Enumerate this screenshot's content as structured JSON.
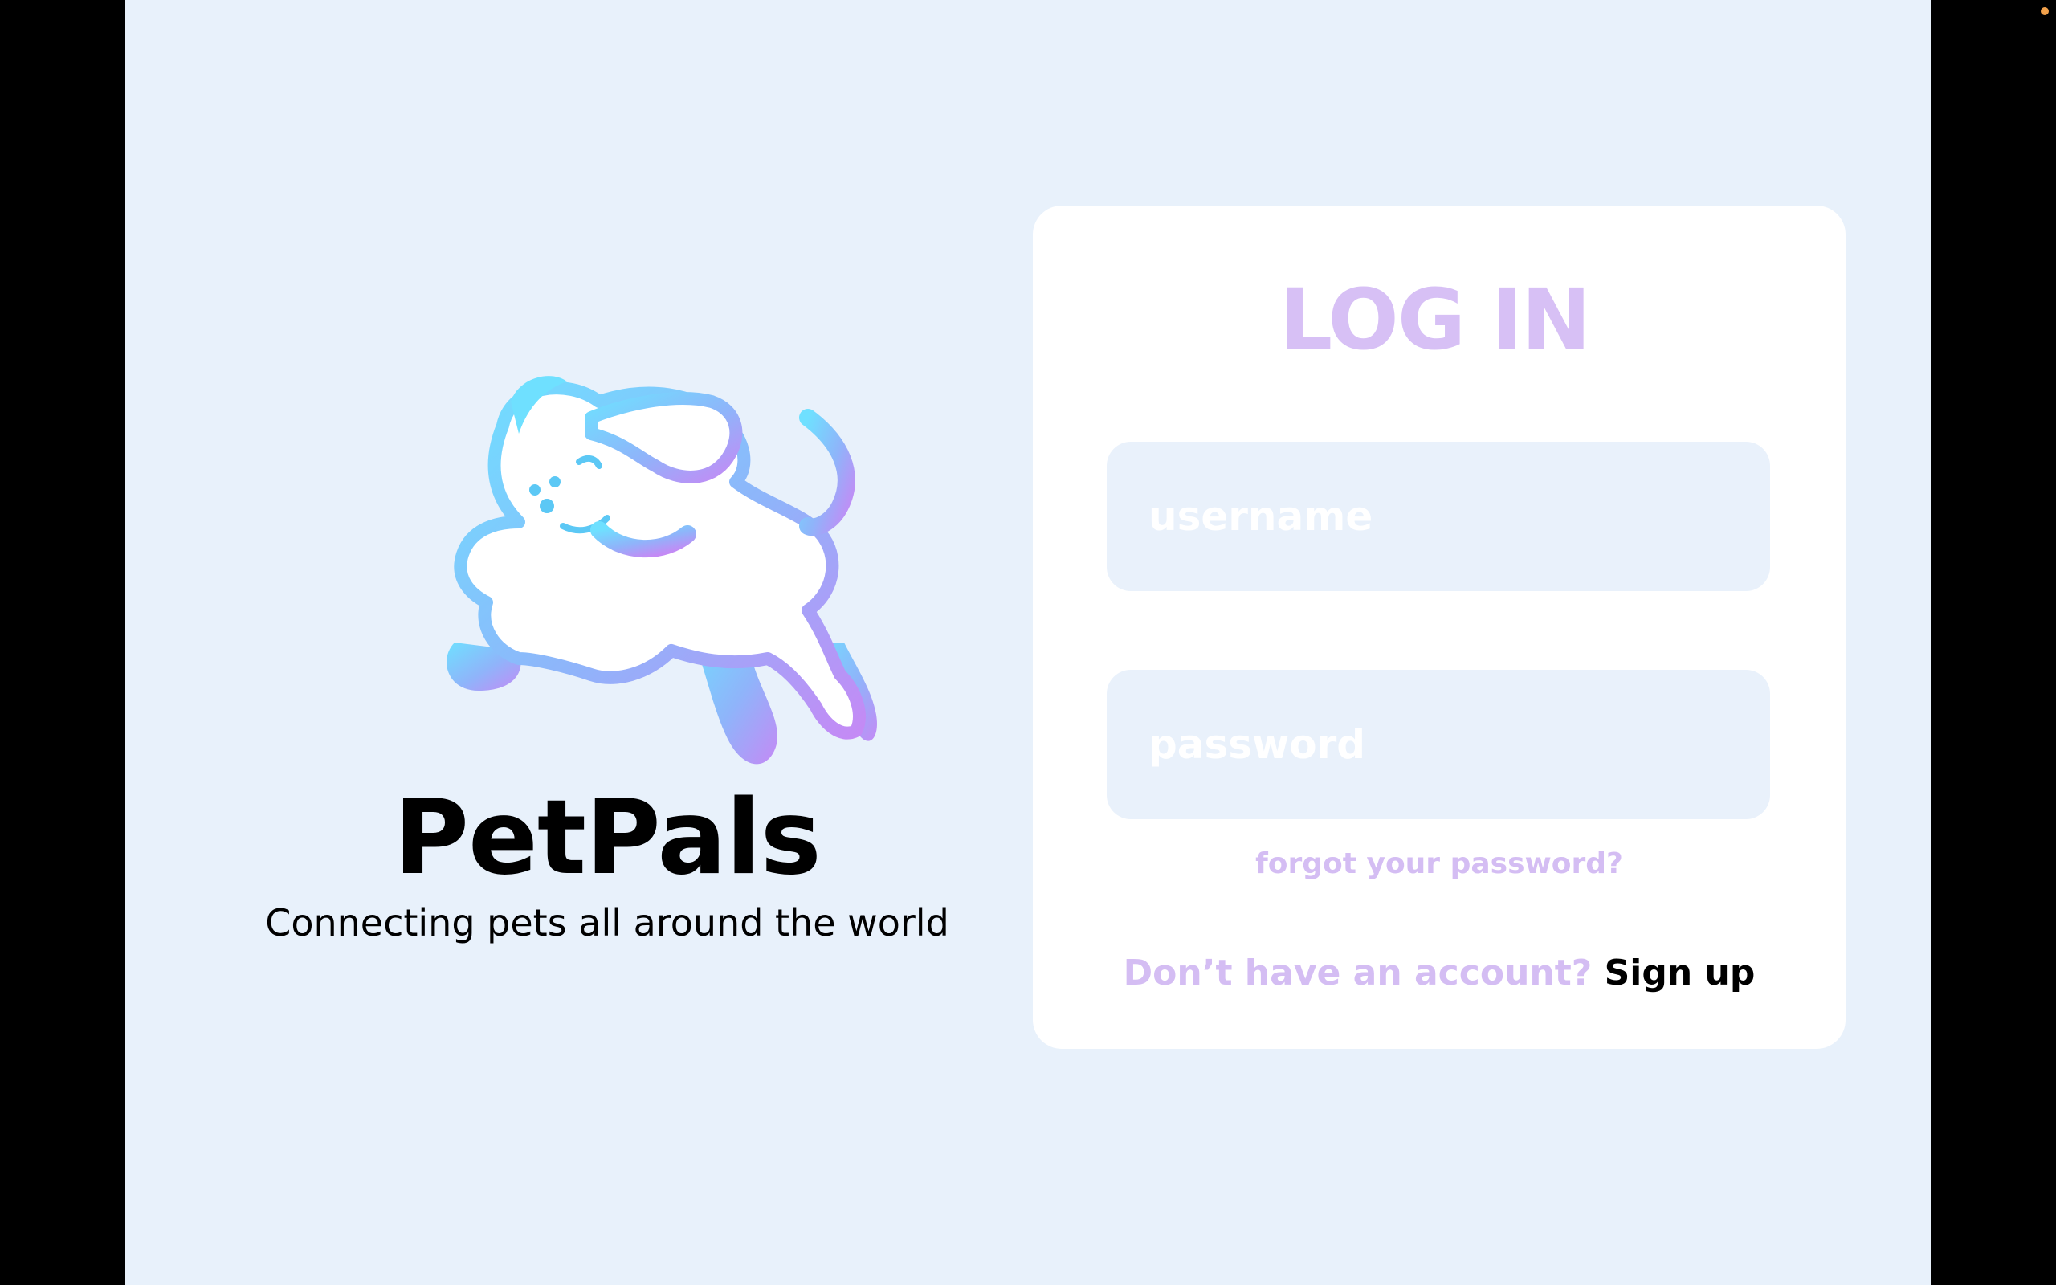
{
  "brand": {
    "app_name": "PetPals",
    "tagline": "Connecting pets all around the world",
    "logo_icon": "running-dog-icon"
  },
  "login": {
    "title": "LOG IN",
    "username_placeholder": "username",
    "username_value": "",
    "password_placeholder": "password",
    "password_value": "",
    "forgot_label": "forgot your password?",
    "signup_prompt": "Don’t have an account?",
    "signup_label": "Sign up"
  },
  "colors": {
    "background": "#E8F1FB",
    "card": "#FFFFFF",
    "field": "#E9F1FB",
    "accent_lavender": "#D4BDF3",
    "logo_gradient_start": "#6FE0FF",
    "logo_gradient_end": "#C48AF5",
    "text_dark": "#000000"
  }
}
